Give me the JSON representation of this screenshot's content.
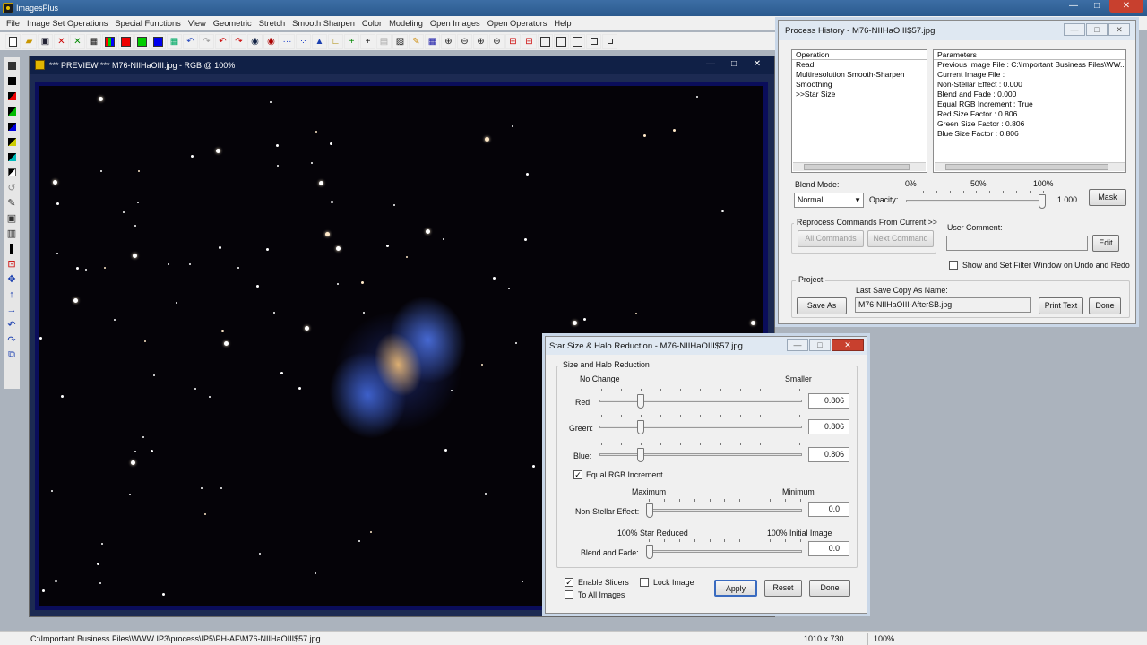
{
  "app": {
    "title": "ImagesPlus"
  },
  "window_buttons": {
    "minimize": "—",
    "maximize": "□",
    "close": "✕"
  },
  "menu": [
    "File",
    "Image Set Operations",
    "Special Functions",
    "View",
    "Geometric",
    "Stretch",
    "Smooth Sharpen",
    "Color",
    "Modeling",
    "Open Images",
    "Open Operators",
    "Help"
  ],
  "preview": {
    "title": "*** PREVIEW *** M76-NIIHaOIII.jpg - RGB @ 100%"
  },
  "process_history": {
    "title": "Process History - M76-NIIHaOIII$57.jpg",
    "operation_header": "Operation",
    "operations": [
      "Read",
      "Multiresolution Smooth-Sharpen",
      "Smoothing",
      ">>Star Size"
    ],
    "parameters_header": "Parameters",
    "parameters": [
      "Previous Image File : C:\\Important Business Files\\WW...",
      "Current Image File :",
      "Non-Stellar Effect : 0.000",
      "Blend and Fade : 0.000",
      "Equal RGB Increment : True",
      "Red Size Factor : 0.806",
      "Green Size Factor : 0.806",
      "Blue Size Factor : 0.806"
    ],
    "blend_mode_label": "Blend Mode:",
    "blend_mode_value": "Normal",
    "opacity_label": "Opacity:",
    "opacity_ticks": [
      "0%",
      "50%",
      "100%"
    ],
    "opacity_value": "1.000",
    "opacity_level": 1.0,
    "mask_button": "Mask",
    "reprocess_group": "Reprocess Commands From Current >>",
    "all_commands_button": "All Commands",
    "next_command_button": "Next Command",
    "user_comment_label": "User Comment:",
    "user_comment_value": "",
    "edit_button": "Edit",
    "show_filter_label": "Show and Set Filter Window on Undo and Redo",
    "show_filter_checked": false,
    "project_group": "Project",
    "save_as_button": "Save As",
    "last_save_label": "Last Save Copy As Name:",
    "last_save_value": "M76-NIIHaOIII-AfterSB.jpg",
    "print_text_button": "Print Text",
    "done_button": "Done"
  },
  "star_dialog": {
    "title": "Star Size & Halo Reduction - M76-NIIHaOIII$57.jpg",
    "group_title": "Size and Halo Reduction",
    "left_caption": "No Change",
    "right_caption": "Smaller",
    "red_label": "Red",
    "red_value": "0.806",
    "green_label": "Green:",
    "green_value": "0.806",
    "blue_label": "Blue:",
    "blue_value": "0.806",
    "equal_rgb_label": "Equal RGB Increment",
    "equal_rgb_checked": true,
    "max_caption": "Maximum",
    "min_caption": "Minimum",
    "non_stellar_label": "Non-Stellar Effect:",
    "non_stellar_value": "0.0",
    "star_reduced_caption": "100% Star Reduced",
    "initial_image_caption": "100% Initial Image",
    "blend_fade_label": "Blend and Fade:",
    "blend_fade_value": "0.0",
    "enable_sliders_label": "Enable Sliders",
    "enable_sliders_checked": true,
    "lock_image_label": "Lock Image",
    "lock_image_checked": false,
    "to_all_images_label": "To All Images",
    "to_all_images_checked": false,
    "apply_button": "Apply",
    "reset_button": "Reset",
    "done_button": "Done"
  },
  "status": {
    "path": "C:\\Important Business Files\\WWW IP3\\process\\IP5\\PH-AF\\M76-NIIHaOIII$57.jpg",
    "dimensions": "1010 x 730",
    "zoom": "100%"
  },
  "colors": {
    "sky": "#050308",
    "frame": "#0a0d5a",
    "title_dark": "#102046",
    "close_red": "#c8402e"
  }
}
